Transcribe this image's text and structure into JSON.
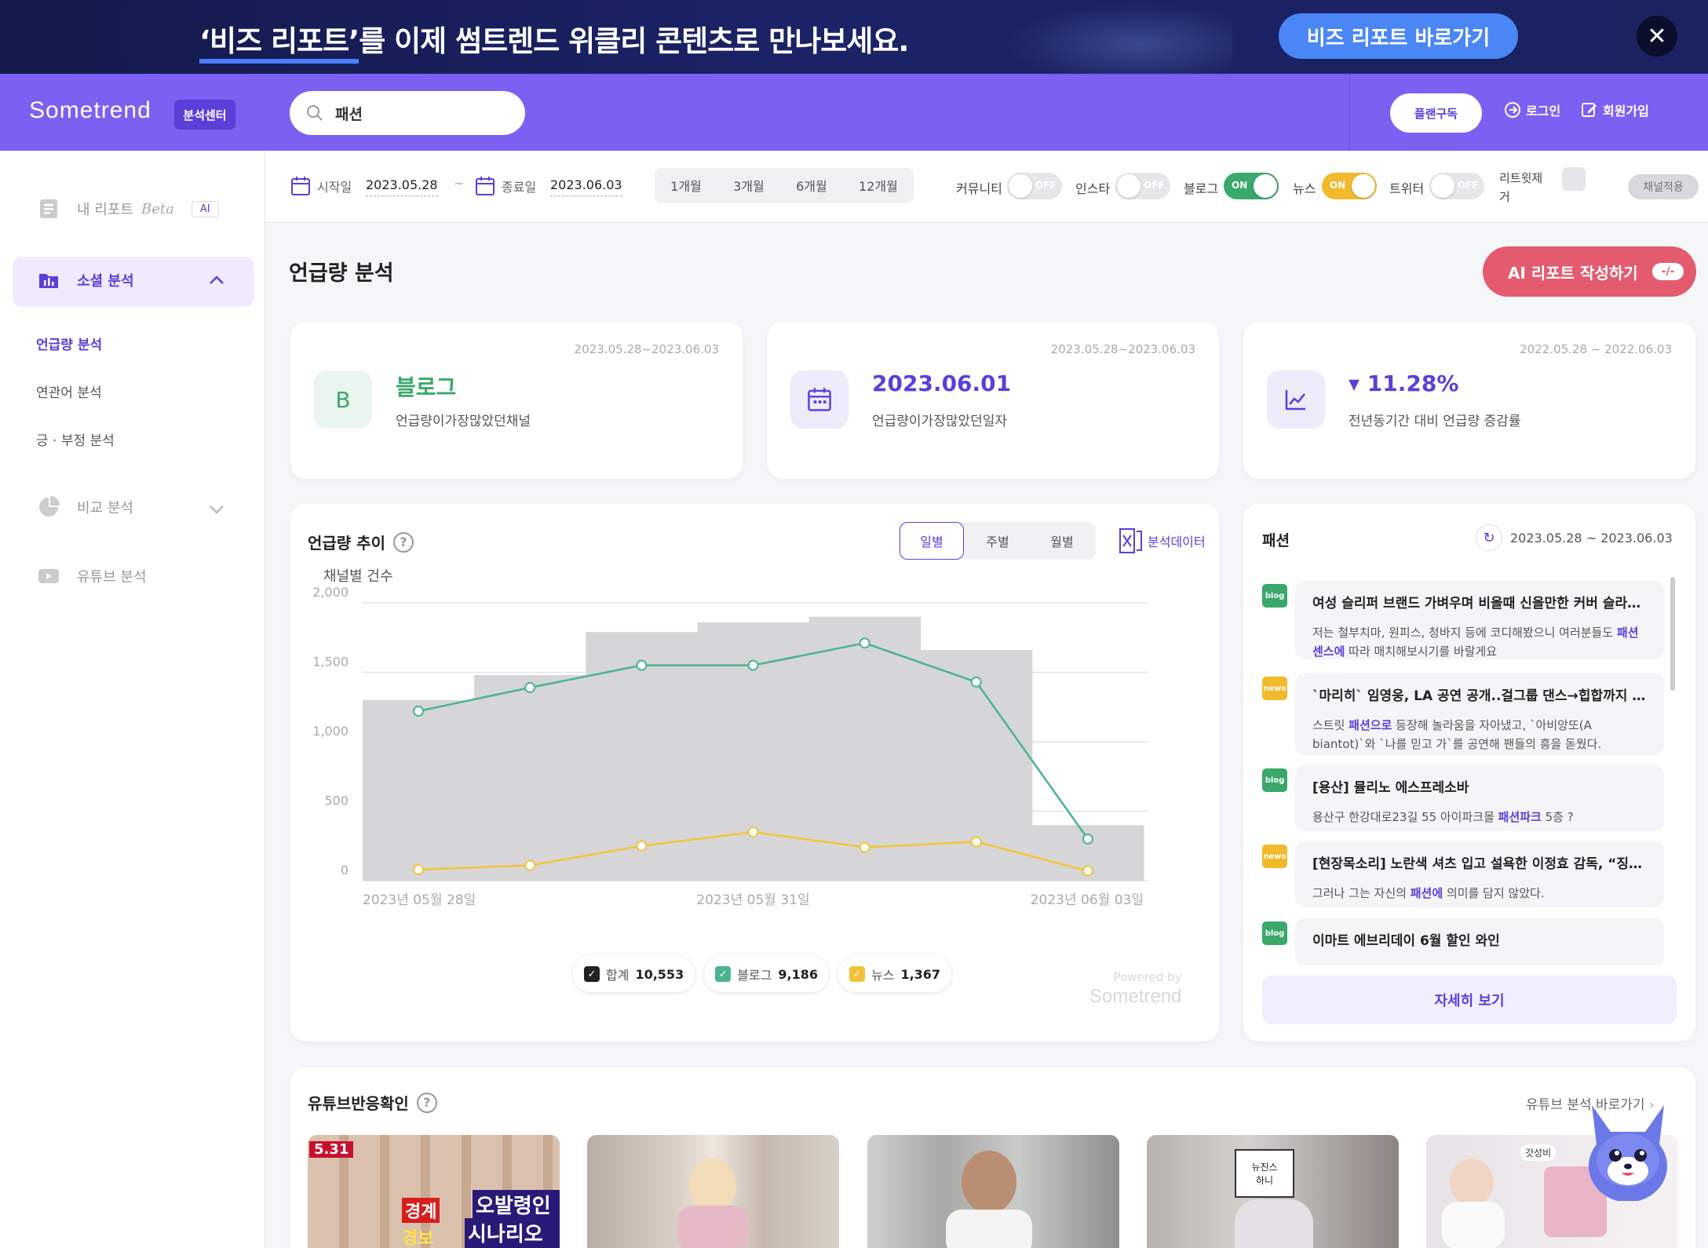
{
  "banner": {
    "text_highlight": "‘비즈 리포트’",
    "text_rest": "를 이제 썸트렌드 위클리 콘텐츠로 만나보세요.",
    "button": "비즈 리포트 바로가기",
    "close": "✕"
  },
  "header": {
    "logo": "Sometrend",
    "badge": "분석센터",
    "search_value": "패션",
    "plan_button": "플랜구독",
    "login": "로그인",
    "signup": "회원가입"
  },
  "sidebar": {
    "my_report": "내 리포트",
    "my_report_beta": "Beta",
    "my_report_ai": "AI",
    "social": "소셜 분석",
    "sub_items": [
      "언급량 분석",
      "연관어 분석",
      "긍 · 부정 분석"
    ],
    "compare": "비교 분석",
    "youtube": "유튜브 분석"
  },
  "filter": {
    "start_label": "시작일",
    "start_value": "2023.05.28",
    "dash": "~",
    "end_label": "종료일",
    "end_value": "2023.06.03",
    "periods": [
      "1개월",
      "3개월",
      "6개월",
      "12개월"
    ],
    "channels": [
      {
        "label": "커뮤니티",
        "state": "OFF",
        "on": false
      },
      {
        "label": "인스타",
        "state": "OFF",
        "on": false
      },
      {
        "label": "블로그",
        "state": "ON",
        "on": true,
        "color": "#3aa86b"
      },
      {
        "label": "뉴스",
        "state": "ON",
        "on": true,
        "color": "#f2b92c"
      },
      {
        "label": "트위터",
        "state": "OFF",
        "on": false
      }
    ],
    "retweet_label_1": "리트윗제",
    "retweet_label_2": "거",
    "apply": "채널적용"
  },
  "main": {
    "title": "언급량 분석",
    "ai_button": "AI 리포트 작성하기",
    "ai_pill": "-/-"
  },
  "kpis": [
    {
      "date": "2023.05.28~2023.06.03",
      "icon": "B",
      "value": "블로그",
      "sub": "언급량이가장많았던채널",
      "color": "#3aa86b",
      "icon_bg": "#eaf5ef"
    },
    {
      "date": "2023.05.28~2023.06.03",
      "icon": "calendar-icon",
      "value": "2023.06.01",
      "sub": "언급량이가장많았던일자",
      "color": "#5b3fd9",
      "icon_bg": "#eeebfb"
    },
    {
      "date": "2022.05.28 ~ 2022.06.03",
      "icon": "trend-icon",
      "value": "▾ 11.28%",
      "sub": "전년동기간 대비 언급량 증감률",
      "color": "#5b3fd9",
      "icon_bg": "#eeebfb"
    }
  ],
  "chart_card": {
    "title": "언급량 추이",
    "help": "?",
    "tabs": [
      "일별",
      "주별",
      "월별"
    ],
    "excel": "분석데이터",
    "legend": [
      {
        "label": "합계",
        "value": "10,553",
        "color": "#222222"
      },
      {
        "label": "블로그",
        "value": "9,186",
        "color": "#4bb38f"
      },
      {
        "label": "뉴스",
        "value": "1,367",
        "color": "#f2c33a"
      }
    ],
    "powered_by": "Powered by",
    "powered_logo": "Sometrend"
  },
  "chart_data": {
    "type": "line",
    "title": "",
    "ylabel": "채널별 건수",
    "ylim": [
      0,
      2000
    ],
    "yticks": [
      0,
      500,
      1000,
      1500,
      2000
    ],
    "ytick_labels": [
      "0",
      "500",
      "1,000",
      "1,500",
      "2,000"
    ],
    "x": [
      "2023-05-28",
      "2023-05-29",
      "2023-05-30",
      "2023-05-31",
      "2023-06-01",
      "2023-06-02",
      "2023-06-03"
    ],
    "xtick_labels": [
      "2023년 05월 28일",
      "2023년 05월 31일",
      "2023년 06월 03일"
    ],
    "xtick_index": [
      0,
      3,
      6
    ],
    "series": [
      {
        "name": "합계",
        "kind": "bar",
        "color": "#d6d6d9",
        "values": [
          1300,
          1480,
          1790,
          1860,
          1900,
          1660,
          400
        ]
      },
      {
        "name": "블로그",
        "kind": "line",
        "color": "#4bb38f",
        "values": [
          1220,
          1390,
          1550,
          1550,
          1710,
          1430,
          300
        ]
      },
      {
        "name": "뉴스",
        "kind": "line",
        "color": "#f2c33a",
        "values": [
          80,
          110,
          250,
          350,
          240,
          280,
          70
        ]
      }
    ],
    "grid": true,
    "legend_position": "bottom"
  },
  "news_card": {
    "title": "패션",
    "date": "2023.05.28 ~ 2023.06.03",
    "items": [
      {
        "type": "blog",
        "title": "여성 슬리퍼 브랜드 가벼우며 비올때 신을만한 커버 슬라이드",
        "body_pre": "저는 철부치마, 원피스, 청바지 등에 코디해봤으니 여러분들도 ",
        "keyword": "패션 센스에",
        "body_post": " 따라 매치해보시기를 바랄게요"
      },
      {
        "type": "news",
        "title": "`마리히` 임영웅, LA 공연 공개..걸그룹 댄스→힙합까지 소화",
        "body_pre": "스트릿 ",
        "keyword": "패션으로",
        "body_post": " 등장해 놀라움을 자아냈고, `아비앙또(A biantot)`와 `나를 믿고 가`를 공연해 팬들의 흥을 돋웠다."
      },
      {
        "type": "blog",
        "title": "[용산] 뮬리노 에스프레소바",
        "body_pre": "용산구 한강대로23길 55 아이파크몰 ",
        "keyword": "패션파크",
        "body_post": " 5층 ?"
      },
      {
        "type": "news",
        "title": "[현장목소리] 노란색 셔츠 입고 설욕한 이정효 감독, “징크스”",
        "body_pre": "그러나 그는 자신의 ",
        "keyword": "패션에",
        "body_post": " 의미를 담지 않았다."
      },
      {
        "type": "blog",
        "title": "이마트 에브리데이 6월 할인 와인",
        "body_pre": "",
        "keyword": "",
        "body_post": ""
      }
    ],
    "more": "자세히 보기"
  },
  "youtube": {
    "title": "유튜브반응확인",
    "help": "?",
    "link": "유튜브 분석 바로가기",
    "thumb1_date": "5.31",
    "thumb1_caption_a": "오발령인가",
    "thumb1_caption_b": "시나리오인가",
    "thumb1_caption_c": "경계",
    "thumb1_caption_d": "경보",
    "thumb4_label": "뉴진스\n하니",
    "thumb5_label": "갓성비"
  }
}
